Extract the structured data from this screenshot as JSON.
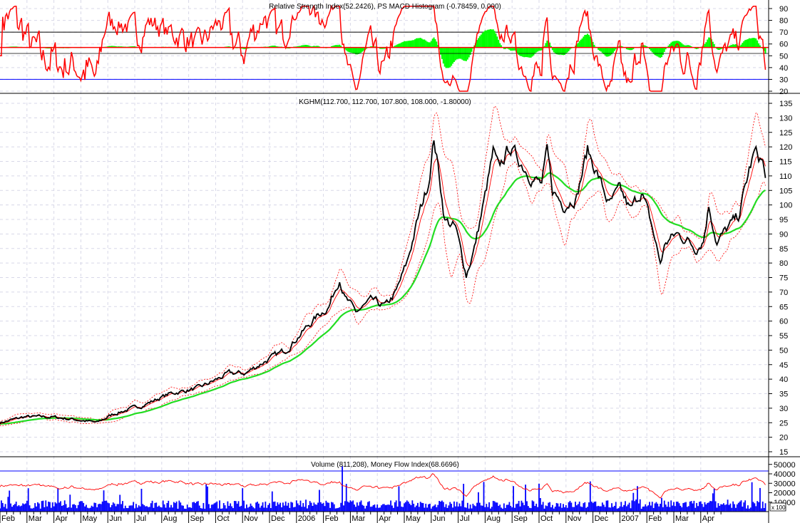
{
  "chart_data": [
    {
      "type": "line",
      "panel": "rsi",
      "title": "Relative Strength Index(52.2426), PS MACD Histogram (-0.78459, 0.000)",
      "y_ticks": [
        "90",
        "80",
        "70",
        "60",
        "50",
        "40",
        "30",
        "20"
      ],
      "ylim": [
        15,
        95
      ],
      "reference_levels": [
        70,
        30
      ],
      "center_level": 57,
      "series": [
        {
          "name": "RSI",
          "color": "#ff0000",
          "last": 52.2426
        },
        {
          "name": "PS MACD Histogram",
          "color": "#00ff00",
          "last": -0.78459
        }
      ]
    },
    {
      "type": "line",
      "panel": "price",
      "title": "KGHM(112.700, 112.700, 107.800, 108.000, -1.80000)",
      "y_ticks": [
        "135",
        "130",
        "125",
        "120",
        "115",
        "110",
        "105",
        "100",
        "95",
        "90",
        "85",
        "80",
        "75",
        "70",
        "65",
        "60",
        "55",
        "50",
        "45",
        "40",
        "35",
        "30",
        "25",
        "20",
        "15"
      ],
      "ylim": [
        12.5,
        137
      ],
      "x_unit": "months since Feb 2005",
      "x_labels": [
        "Feb",
        "Mar",
        "Apr",
        "May",
        "Jun",
        "Jul",
        "Aug",
        "Sep",
        "Oct",
        "Nov",
        "Dec",
        "2006",
        "Feb",
        "Mar",
        "Apr",
        "May",
        "Jun",
        "Jul",
        "Aug",
        "Sep",
        "Oct",
        "Nov",
        "Dec",
        "2007",
        "Feb",
        "Mar",
        "Apr"
      ],
      "series": [
        {
          "name": "KGHM close",
          "color": "#000000",
          "points": [
            [
              0,
              25
            ],
            [
              0.9,
              27
            ],
            [
              1.9,
              27
            ],
            [
              2.9,
              26
            ],
            [
              3.6,
              25
            ],
            [
              4.2,
              28
            ],
            [
              5.3,
              31
            ],
            [
              6.3,
              35
            ],
            [
              7.4,
              37
            ],
            [
              8.5,
              42
            ],
            [
              9.1,
              42
            ],
            [
              9.8,
              46
            ],
            [
              10.6,
              50
            ],
            [
              11.1,
              55
            ],
            [
              11.8,
              62
            ],
            [
              12.2,
              65
            ],
            [
              12.6,
              75
            ],
            [
              12.8,
              68
            ],
            [
              13.2,
              63
            ],
            [
              13.8,
              67
            ],
            [
              14.3,
              65
            ],
            [
              14.7,
              70
            ],
            [
              15.1,
              80
            ],
            [
              15.5,
              95
            ],
            [
              15.9,
              108
            ],
            [
              16.1,
              123
            ],
            [
              16.3,
              110
            ],
            [
              16.5,
              95
            ],
            [
              16.9,
              92
            ],
            [
              17.3,
              76
            ],
            [
              17.6,
              85
            ],
            [
              18.0,
              103
            ],
            [
              18.3,
              118
            ],
            [
              18.5,
              112
            ],
            [
              18.9,
              120
            ],
            [
              19.3,
              115
            ],
            [
              19.7,
              110
            ],
            [
              20.1,
              107
            ],
            [
              20.3,
              118
            ],
            [
              20.5,
              105
            ],
            [
              20.9,
              100
            ],
            [
              21.4,
              103
            ],
            [
              21.8,
              119
            ],
            [
              22.2,
              110
            ],
            [
              22.6,
              100
            ],
            [
              23.0,
              105
            ],
            [
              23.4,
              98
            ],
            [
              23.8,
              105
            ],
            [
              24.2,
              92
            ],
            [
              24.5,
              80
            ],
            [
              24.7,
              87
            ],
            [
              25.1,
              90
            ],
            [
              25.5,
              88
            ],
            [
              25.8,
              85
            ],
            [
              26.1,
              88
            ],
            [
              26.3,
              100
            ],
            [
              26.6,
              87
            ],
            [
              27.0,
              92
            ],
            [
              27.4,
              96
            ],
            [
              27.8,
              112
            ],
            [
              28.0,
              118
            ],
            [
              28.3,
              115
            ],
            [
              28.4,
              108
            ]
          ]
        },
        {
          "name": "Short moving average",
          "color": "#ff0000"
        },
        {
          "name": "Long moving average",
          "color": "#00dd00"
        },
        {
          "name": "Bollinger bands",
          "color": "#ff0000"
        }
      ]
    },
    {
      "type": "bar",
      "panel": "volume",
      "title": "Volume (811,208), Money Flow Index(68.6696)",
      "y_ticks": [
        "50000",
        "40000",
        "30000",
        "20000",
        "10000"
      ],
      "ylim": [
        0,
        58000
      ],
      "scale_label": "x 100",
      "reference_level": 43000,
      "series": [
        {
          "name": "Volume",
          "color": "#0000ff",
          "last": 811208
        },
        {
          "name": "Money Flow Index",
          "color": "#ff0000",
          "last": 68.6696
        }
      ]
    }
  ]
}
